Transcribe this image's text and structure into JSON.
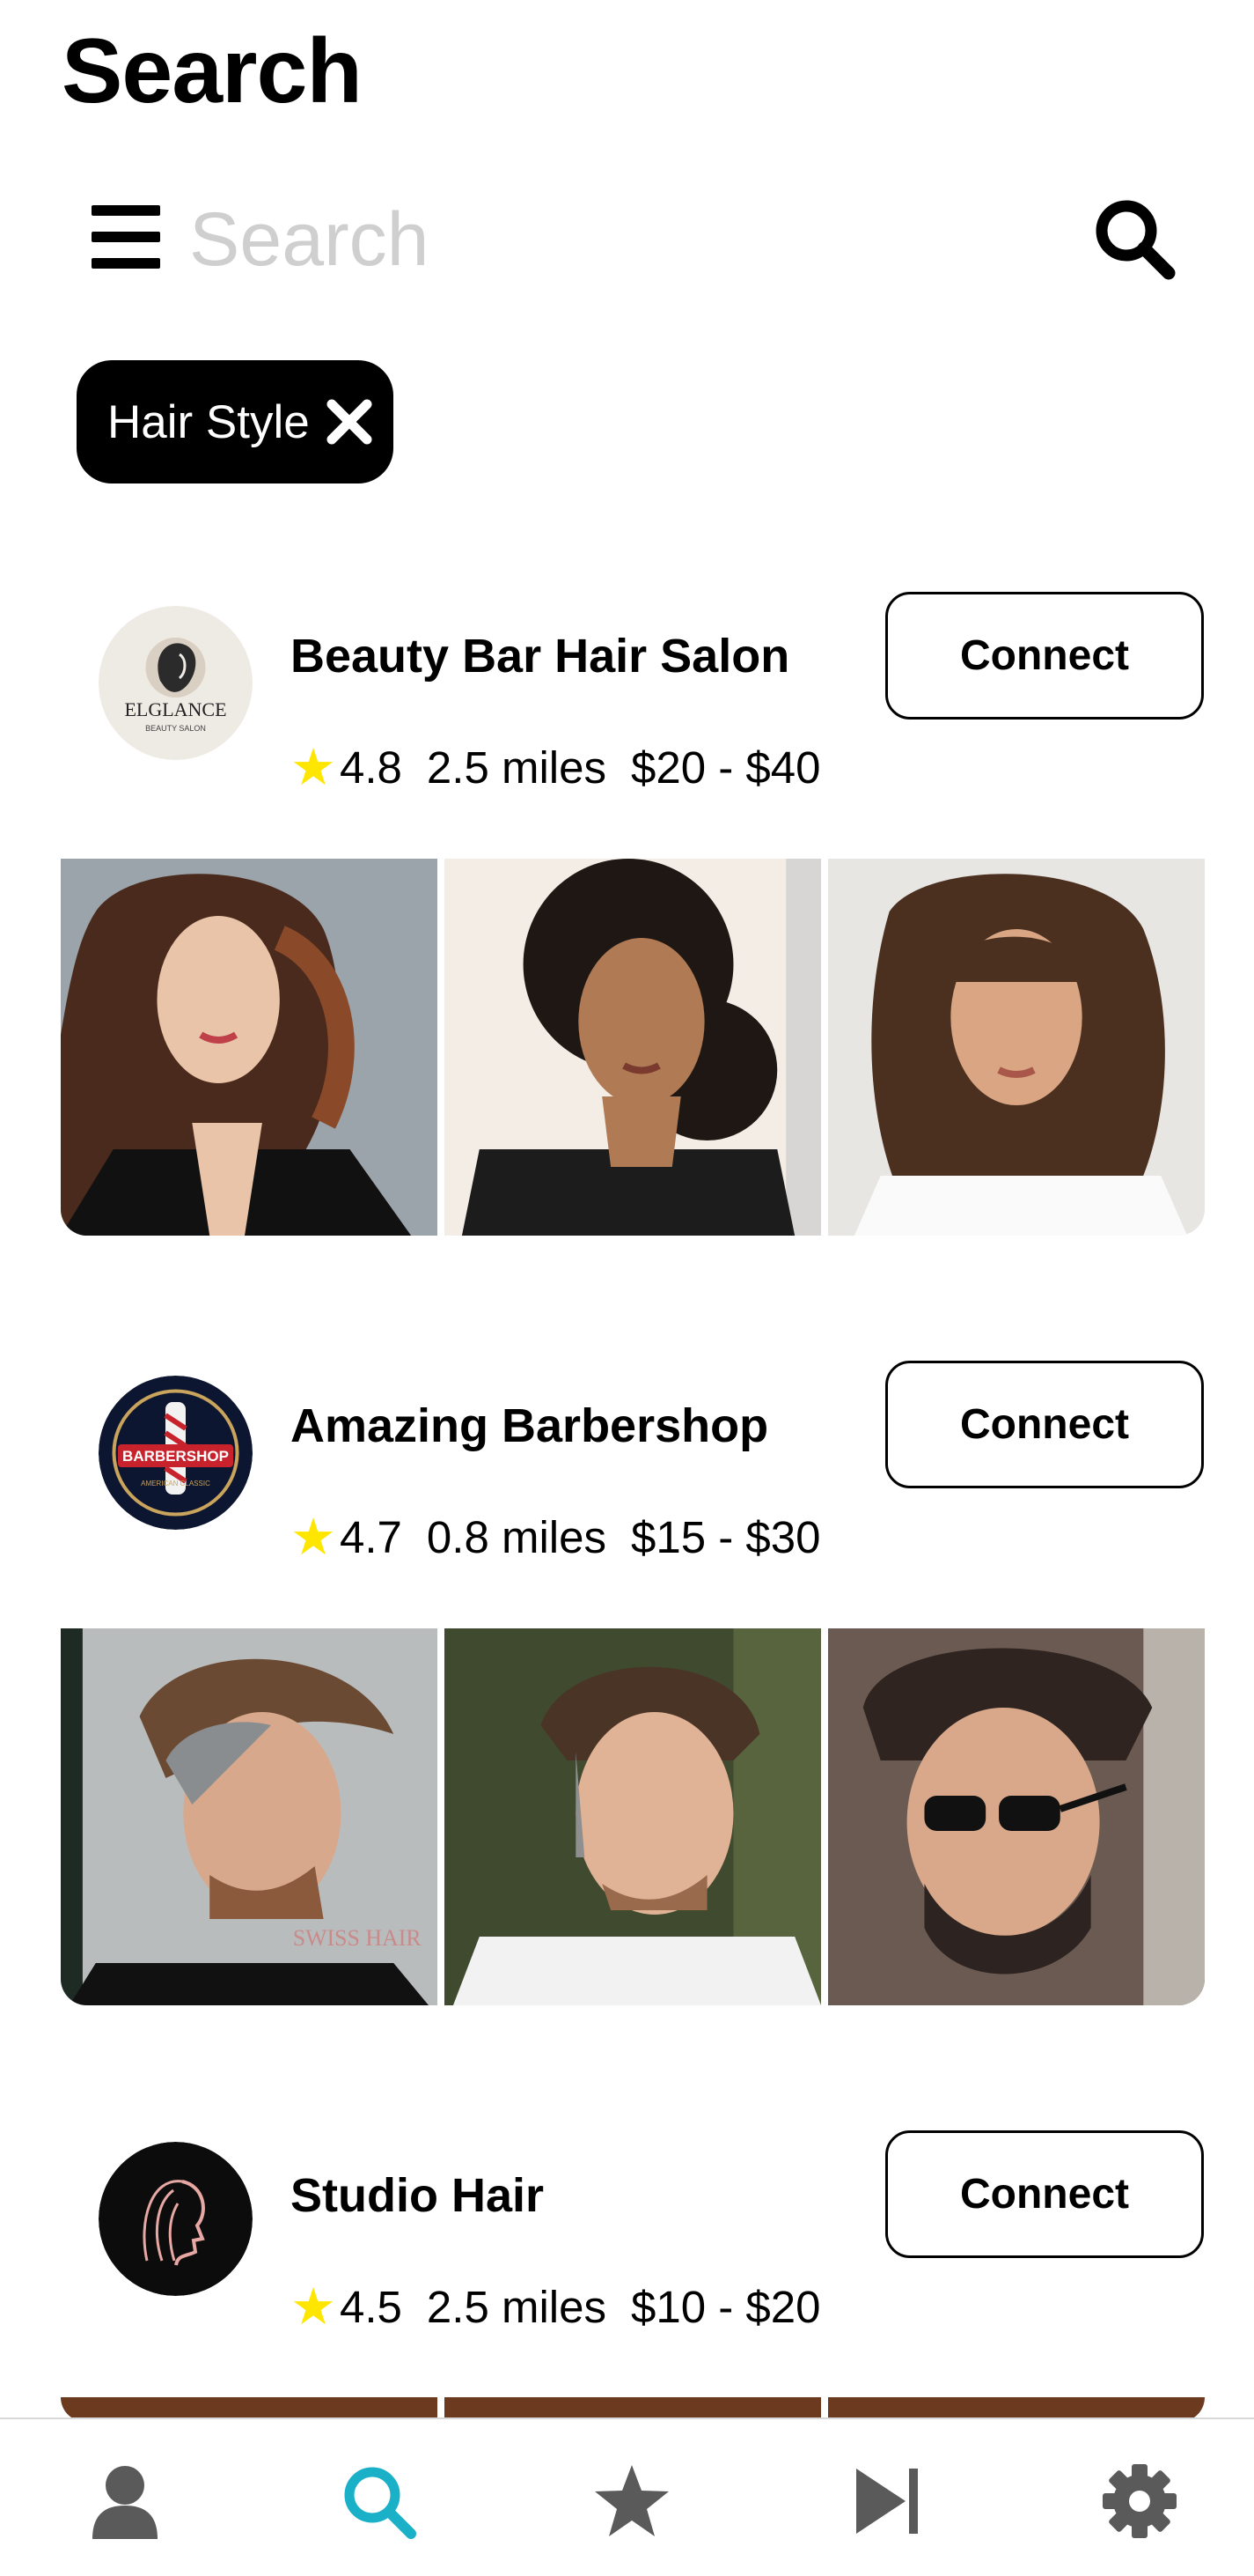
{
  "header": {
    "title": "Search"
  },
  "search": {
    "placeholder": "Search",
    "value": ""
  },
  "filters": [
    {
      "label": "Hair Style"
    }
  ],
  "salons": [
    {
      "name": "Beauty Bar Hair Salon",
      "rating": "4.8",
      "distance": "2.5 miles",
      "price": "$20 - $40",
      "button": "Connect",
      "logo_text": "ELGLANCE",
      "logo_subtext": "BEAUTY SALON"
    },
    {
      "name": "Amazing Barbershop",
      "rating": "4.7",
      "distance": "0.8 miles",
      "price": "$15 - $30",
      "button": "Connect",
      "logo_text": "BARBERSHOP",
      "logo_subtext": "AMERICAN CLASSIC"
    },
    {
      "name": "Studio Hair",
      "rating": "4.5",
      "distance": "2.5 miles",
      "price": "$10 - $20",
      "button": "Connect"
    }
  ],
  "photo_watermark": "SWISS HAIR",
  "bottom_nav": [
    {
      "icon": "profile-icon",
      "active": false
    },
    {
      "icon": "search-icon",
      "active": true
    },
    {
      "icon": "star-icon",
      "active": false
    },
    {
      "icon": "skip-icon",
      "active": false
    },
    {
      "icon": "gear-icon",
      "active": false
    }
  ],
  "colors": {
    "accent": "#1ab0c8",
    "star": "#ffe600",
    "nav_inactive": "#5a5a5a",
    "placeholder": "#cfcfcf"
  }
}
